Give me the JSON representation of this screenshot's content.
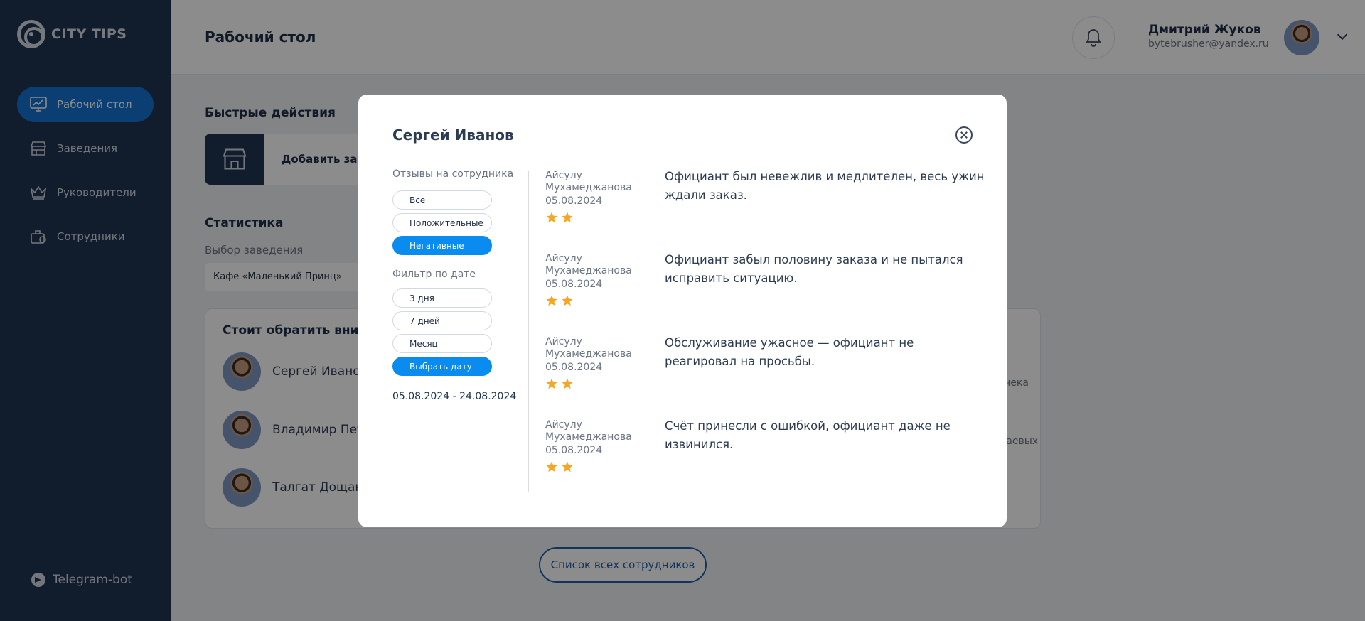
{
  "brand": {
    "name": "CITY TIPS"
  },
  "sidebar": {
    "items": [
      {
        "label": "Рабочий стол",
        "icon": "chart-icon"
      },
      {
        "label": "Заведения",
        "icon": "store-icon"
      },
      {
        "label": "Руководители",
        "icon": "crown-icon"
      },
      {
        "label": "Сотрудники",
        "icon": "employee-icon"
      }
    ],
    "telegram": "Telegram-bot"
  },
  "header": {
    "title": "Рабочий стол",
    "user_name": "Дмитрий Жуков",
    "user_email": "bytebrusher@yandex.ru"
  },
  "main": {
    "quick_title": "Быстрые действия",
    "quick_action": "Добавить заведение",
    "stats_title": "Статистика",
    "select_label": "Выбор заведения",
    "select_value": "Кафе «Маленький Принц»",
    "attention_title": "Стоит обратить внимание",
    "employees": [
      "Сергей Иванов",
      "Владимир Петров",
      "Талгат Дощанов"
    ],
    "side_note_1": "чека",
    "side_note_2": "чаевых",
    "all_button": "Список всех сотрудников"
  },
  "modal": {
    "title": "Сергей Иванов",
    "reviews_label": "Отзывы на сотрудника",
    "review_filters": [
      {
        "label": "Все",
        "active": false
      },
      {
        "label": "Положительные",
        "active": false
      },
      {
        "label": "Негативные",
        "active": true
      }
    ],
    "date_label": "Фильтр по дате",
    "date_filters": [
      {
        "label": "3 дня",
        "active": false
      },
      {
        "label": "7 дней",
        "active": false
      },
      {
        "label": "Месяц",
        "active": false
      },
      {
        "label": "Выбрать дату",
        "active": true
      }
    ],
    "date_range": "05.08.2024 - 24.08.2024",
    "reviews": [
      {
        "author": "Айсулу Мухамеджанова",
        "date": "05.08.2024",
        "stars": 2,
        "text": "Официант был невежлив и медлителен, весь ужин ждали заказ."
      },
      {
        "author": "Айсулу Мухамеджанова",
        "date": "05.08.2024",
        "stars": 2,
        "text": "Официант забыл половину заказа и не пытался исправить ситуацию."
      },
      {
        "author": "Айсулу Мухамеджанова",
        "date": "05.08.2024",
        "stars": 2,
        "text": "Обслуживание ужасное — официант не реагировал на просьбы."
      },
      {
        "author": "Айсулу Мухамеджанова",
        "date": "05.08.2024",
        "stars": 2,
        "text": "Счёт принесли с ошибкой, официант даже не извинился."
      }
    ]
  },
  "colors": {
    "sidebar": "#1f3350",
    "accent": "#0a8bf0",
    "nav_active": "#1574d4",
    "star": "#f5a623"
  }
}
